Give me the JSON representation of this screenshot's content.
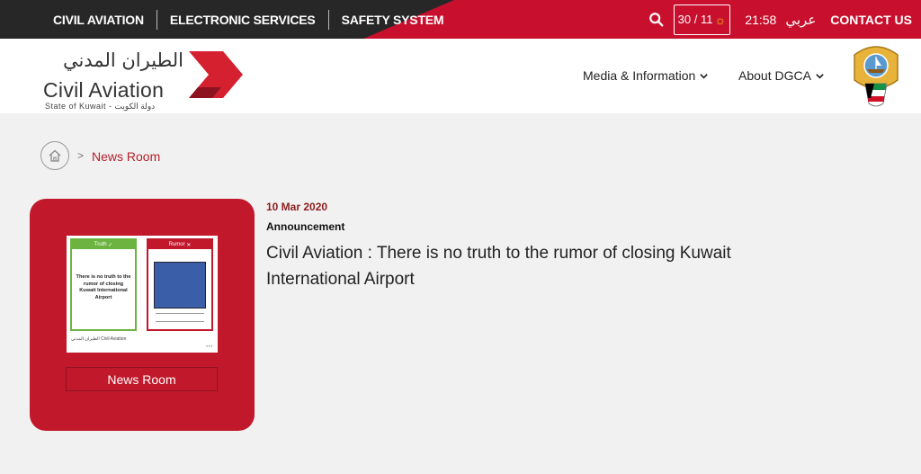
{
  "topbar": {
    "nav": [
      "CIVIL AVIATION",
      "ELECTRONIC SERVICES",
      "SAFETY SYSTEM"
    ],
    "weather": "30 / 11",
    "time": "21:58",
    "language": "عربي",
    "contact": "CONTACT US"
  },
  "logo": {
    "arabic": "الطيران المدني",
    "english": "Civil Aviation",
    "subtitle": "State of Kuwait - دولة الكويت"
  },
  "mainnav": [
    "Media & Information",
    "About DGCA"
  ],
  "breadcrumb": {
    "current": "News Room"
  },
  "card": {
    "label": "News Room",
    "thumb_truth": "Truth",
    "thumb_rumor": "Rumor",
    "thumb_text": "There is no truth to the rumor of closing Kuwait International Airport",
    "thumb_logo": "الطيران المدني Civil Aviation"
  },
  "article": {
    "date": "10 Mar 2020",
    "category": "Announcement",
    "title": "Civil Aviation : There is no truth to the rumor of closing Kuwait International Airport"
  },
  "colors": {
    "brand_red": "#c8102e",
    "dark": "#272727",
    "background": "#f1f1f1"
  }
}
